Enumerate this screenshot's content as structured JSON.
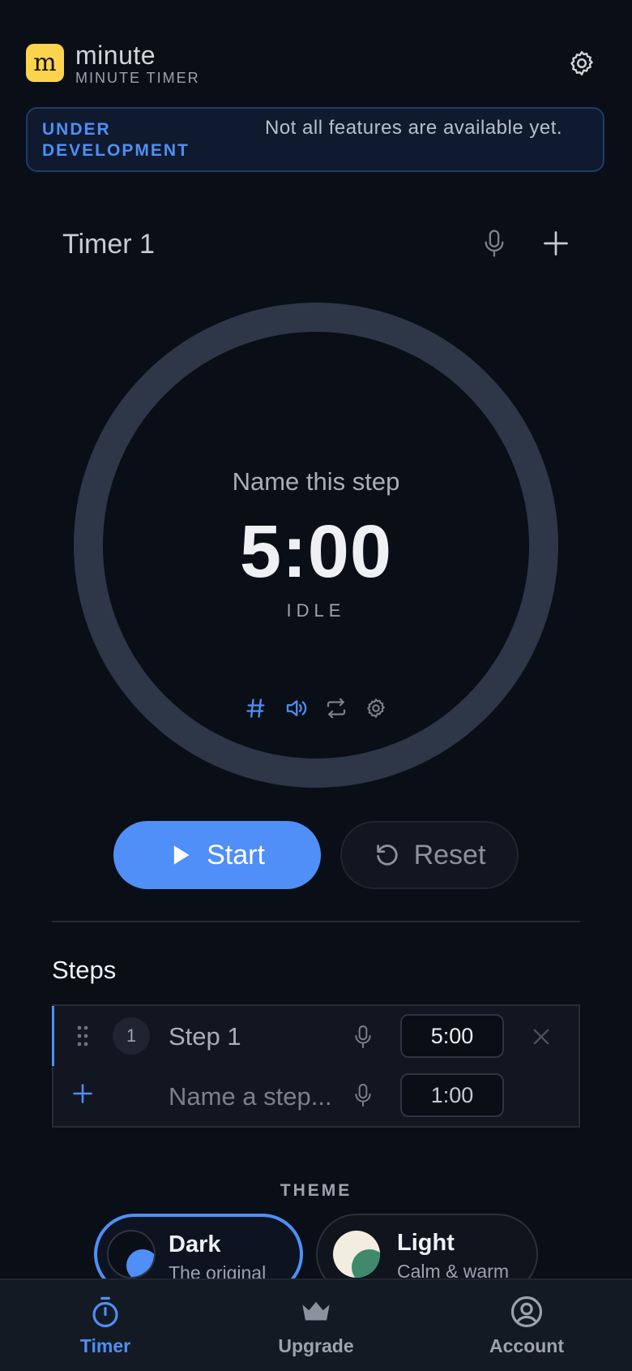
{
  "app": {
    "logo_letter": "m",
    "name": "minute",
    "subtitle": "MINUTE TIMER"
  },
  "banner": {
    "title": "UNDER DEVELOPMENT",
    "text": "Not all features are available yet."
  },
  "timer": {
    "title": "Timer 1",
    "step_name": "Name this step",
    "time": "5:00",
    "status": "IDLE",
    "progress": 0
  },
  "controls": {
    "start_label": "Start",
    "reset_label": "Reset"
  },
  "steps": {
    "title": "Steps",
    "items": [
      {
        "number": "1",
        "label": "Step 1",
        "duration": "5:00"
      }
    ],
    "new_step": {
      "placeholder": "Name a step...",
      "duration": "1:00"
    }
  },
  "theme": {
    "title": "THEME",
    "options": [
      {
        "name": "Dark",
        "description": "The original",
        "selected": true
      },
      {
        "name": "Light",
        "description": "Calm & warm",
        "selected": false
      }
    ]
  },
  "nav": {
    "items": [
      {
        "label": "Timer",
        "icon": "stopwatch-icon",
        "active": true
      },
      {
        "label": "Upgrade",
        "icon": "crown-icon",
        "active": false
      },
      {
        "label": "Account",
        "icon": "user-circle-icon",
        "active": false
      }
    ]
  },
  "colors": {
    "accent": "#4f8ff7",
    "logo": "#fcd34d",
    "background": "#0a0e16",
    "ring": "#2d3748"
  }
}
